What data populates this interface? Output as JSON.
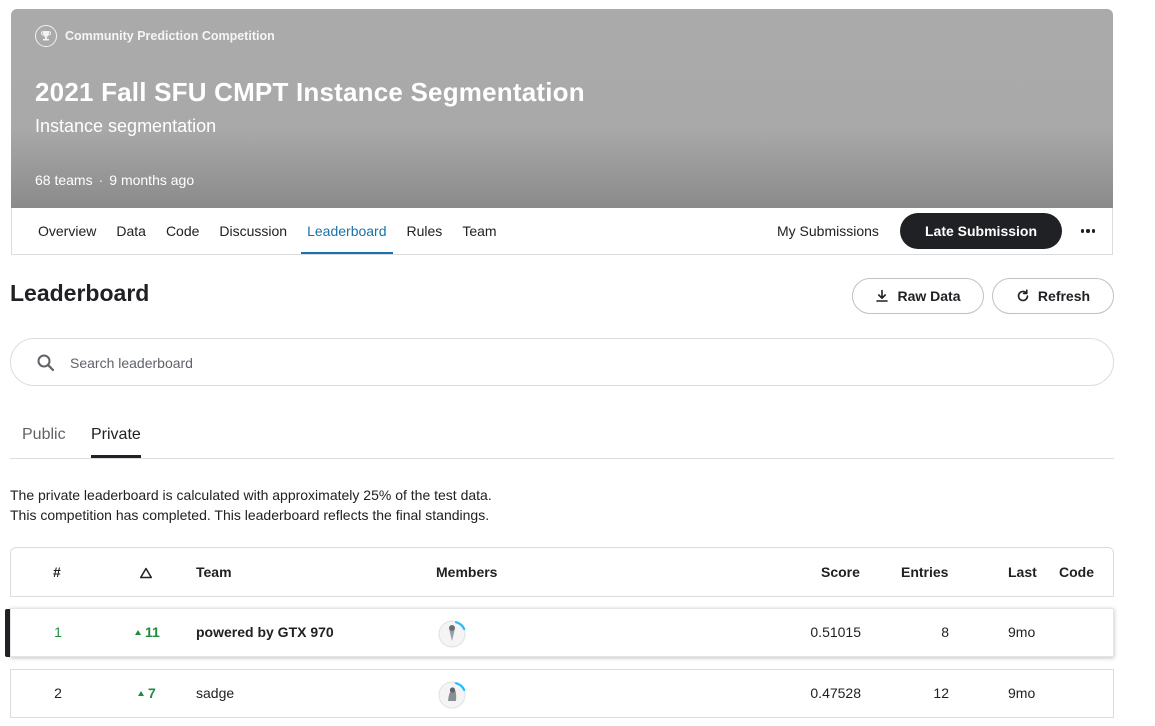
{
  "header": {
    "competition_type": "Community Prediction Competition",
    "title": "2021 Fall SFU CMPT Instance Segmentation",
    "subtitle": "Instance segmentation",
    "teams": "68 teams",
    "separator": "·",
    "age": "9 months ago",
    "banner_color": "#a9a9a9"
  },
  "nav": {
    "tabs": [
      {
        "label": "Overview"
      },
      {
        "label": "Data"
      },
      {
        "label": "Code"
      },
      {
        "label": "Discussion"
      },
      {
        "label": "Leaderboard",
        "active": true
      },
      {
        "label": "Rules"
      },
      {
        "label": "Team"
      }
    ],
    "my_submissions": "My Submissions",
    "late_submission": "Late Submission",
    "more_icon": "more-horizontal-icon"
  },
  "leaderboard": {
    "title": "Leaderboard",
    "raw_data": "Raw Data",
    "refresh": "Refresh",
    "search_placeholder": "Search leaderboard",
    "tabs": [
      {
        "label": "Public"
      },
      {
        "label": "Private",
        "active": true
      }
    ],
    "info_line1": "The private leaderboard is calculated with approximately 25% of the test data.",
    "info_line2": "This competition has completed. This leaderboard reflects the final standings.",
    "columns": {
      "rank": "#",
      "change_icon": "delta-icon",
      "team": "Team",
      "members": "Members",
      "score": "Score",
      "entries": "Entries",
      "last": "Last",
      "code": "Code"
    },
    "rows": [
      {
        "rank": "1",
        "change": "11",
        "team": "powered by GTX 970",
        "score": "0.51015",
        "entries": "8",
        "last": "9mo",
        "highlight": true
      },
      {
        "rank": "2",
        "change": "7",
        "team": "sadge",
        "score": "0.47528",
        "entries": "12",
        "last": "9mo",
        "highlight": false
      }
    ],
    "accent_green": "#1e8e3e",
    "accent_blue": "#1a73a8"
  }
}
